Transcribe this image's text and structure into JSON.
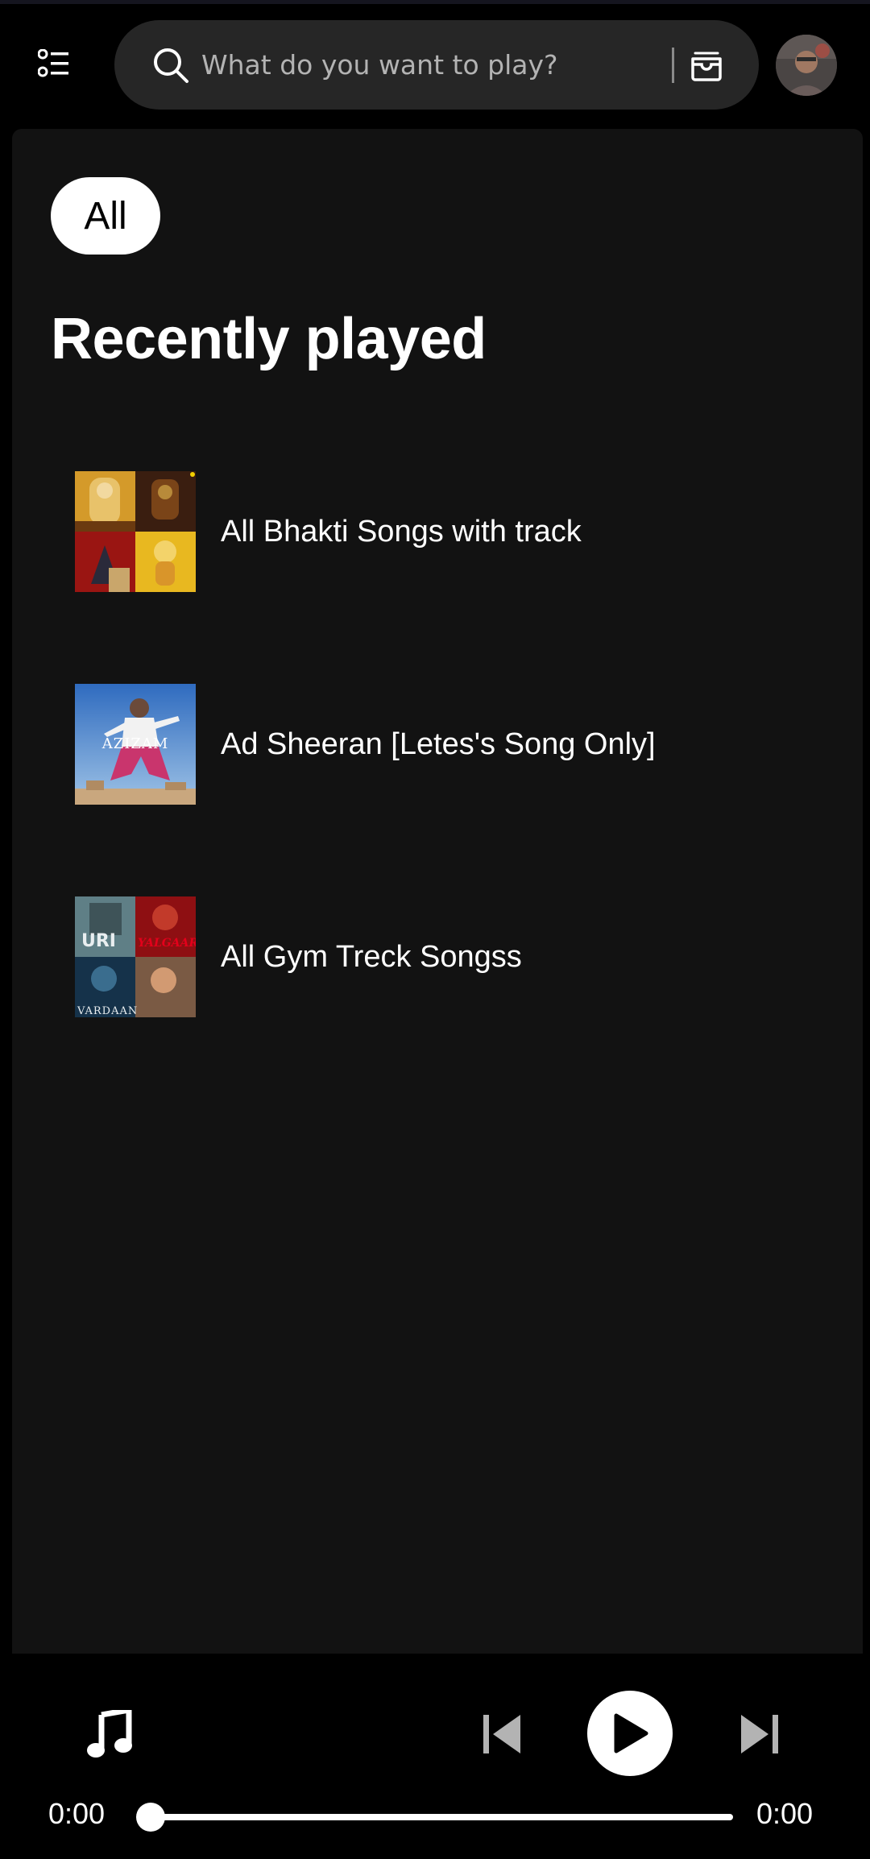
{
  "header": {
    "search_placeholder": "What do you want to play?",
    "menu_icon": "library-list-icon",
    "browse_icon": "browse-icon",
    "avatar_icon": "avatar"
  },
  "filters": {
    "chips": [
      {
        "label": "All",
        "selected": true
      }
    ]
  },
  "recently_played": {
    "title": "Recently played",
    "items": [
      {
        "name": "All Bhakti Songs with track"
      },
      {
        "name": "Ad Sheeran [Letes's Song Only]",
        "cover_text": "AZIZAM"
      },
      {
        "name": "All Gym Treck Songss",
        "cover_texts": [
          "URI",
          "YALGAAR",
          "VARDAAN"
        ]
      }
    ]
  },
  "player": {
    "elapsed": "0:00",
    "total": "0:00",
    "progress": 0,
    "icons": [
      "music-note-icon",
      "skip-previous-icon",
      "play-icon",
      "skip-next-icon"
    ]
  },
  "colors": {
    "background": "#000000",
    "panel": "#121212",
    "search_bg": "#262626",
    "chip_selected_bg": "#ffffff",
    "text": "#ffffff"
  }
}
